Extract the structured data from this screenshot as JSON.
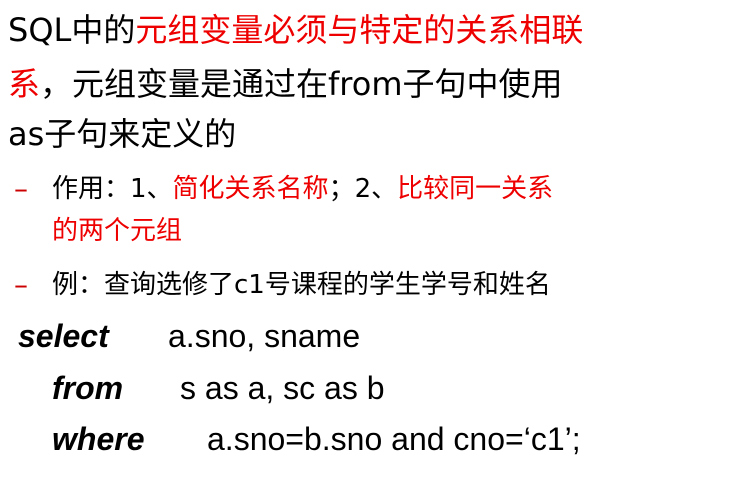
{
  "paragraph": {
    "line1_sql": "SQL中的",
    "line1_red": "元组变量必须与特定的关系相联",
    "line2_red": "系",
    "line2_black": "，元组变量是通过在from子句中使用",
    "line3": "as子句来定义的"
  },
  "bullets": [
    {
      "dash": "–",
      "prefix": "作用：1、",
      "red1": "简化关系名称",
      "mid": "；2、",
      "red2": "比较同一关系",
      "line2_red": "的两个元组"
    },
    {
      "dash": "–",
      "text": "例：查询选修了c1号课程的学生学号和姓名"
    }
  ],
  "code": {
    "select_kw": "select",
    "select_rest": "a.sno, sname",
    "from_kw": "from",
    "from_rest": "s as a, sc as b",
    "where_kw": "where",
    "where_rest": "a.sno=b.sno and cno=‘c1’;"
  },
  "colors": {
    "emphasis": "#ee0000",
    "text": "#000000"
  }
}
